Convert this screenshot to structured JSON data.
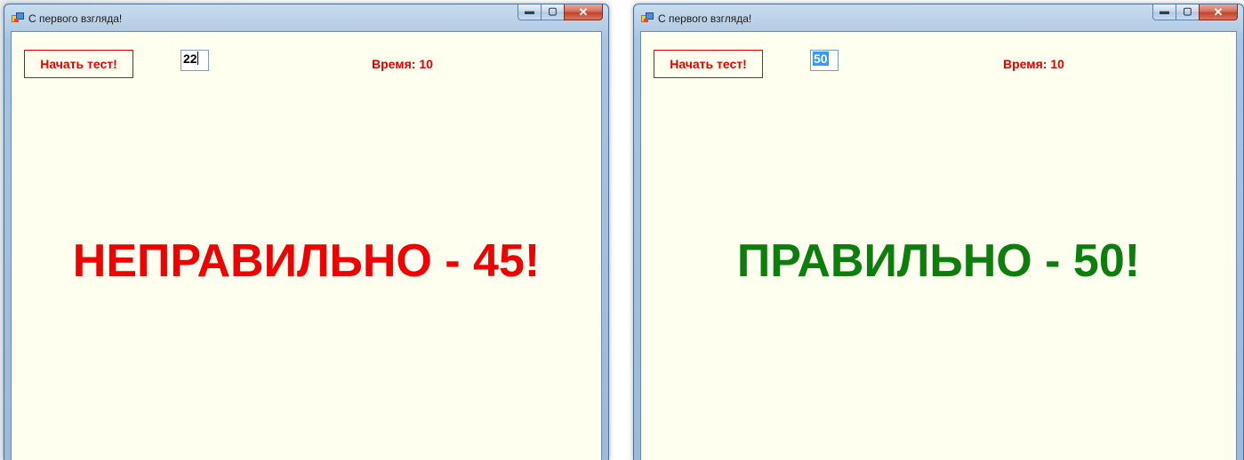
{
  "colors": {
    "client_bg": "#fffff0",
    "red": "#e30000",
    "green": "#0d7d0d",
    "selection": "#3399ff"
  },
  "windows": [
    {
      "title": "С первого взгляда!",
      "icon": "app-window-icon",
      "controls": {
        "minimize": "▬",
        "maximize": "▢",
        "close": "✕"
      },
      "start_button": "Начать тест!",
      "number_input": {
        "value": "22",
        "state": "caret-after-text"
      },
      "timer": "Время: 10",
      "result": {
        "text": "НЕПРАВИЛЬНО - 45!",
        "status": "wrong",
        "color": "#f00000"
      }
    },
    {
      "title": "С первого взгляда!",
      "icon": "app-window-icon",
      "controls": {
        "minimize": "▬",
        "maximize": "▢",
        "close": "✕"
      },
      "start_button": "Начать тест!",
      "number_input": {
        "value": "50",
        "state": "text-selected"
      },
      "timer": "Время: 10",
      "result": {
        "text": "ПРАВИЛЬНО - 50!",
        "status": "correct",
        "color": "#0d7d0d"
      }
    }
  ]
}
